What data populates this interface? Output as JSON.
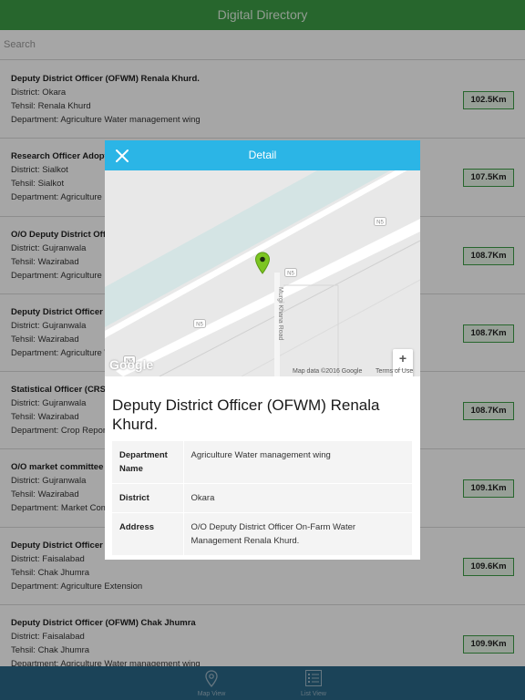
{
  "app": {
    "title": "Digital Directory"
  },
  "search": {
    "placeholder": "Search"
  },
  "list": [
    {
      "title": "Deputy District Officer (OFWM) Renala Khurd.",
      "district": "District: Okara",
      "tehsil": "Tehsil: Renala Khurd",
      "department": "Department: Agriculture Water management wing",
      "distance": "102.5Km"
    },
    {
      "title": "Research Officer Adopti",
      "district": "District: Sialkot",
      "tehsil": "Tehsil: Sialkot",
      "department": "Department: Agriculture F",
      "distance": "107.5Km"
    },
    {
      "title": "O/O Deputy District Offic",
      "district": "District: Gujranwala",
      "tehsil": "Tehsil: Wazirabad",
      "department": "Department: Agriculture E",
      "distance": "108.7Km"
    },
    {
      "title": "Deputy District Officer (C",
      "district": "District: Gujranwala",
      "tehsil": "Tehsil: Wazirabad",
      "department": "Department: Agriculture W",
      "distance": "108.7Km"
    },
    {
      "title": "Statistical Officer (CRS)",
      "district": "District: Gujranwala",
      "tehsil": "Tehsil: Wazirabad",
      "department": "Department: Crop Report",
      "distance": "108.7Km"
    },
    {
      "title": "O/O market committee W",
      "district": "District: Gujranwala",
      "tehsil": "Tehsil: Wazirabad",
      "department": "Department: Market Com",
      "distance": "109.1Km"
    },
    {
      "title": "Deputy District Officer A",
      "district": "District: Faisalabad",
      "tehsil": "Tehsil: Chak Jhumra",
      "department": "Department: Agriculture Extension",
      "distance": "109.6Km"
    },
    {
      "title": "Deputy District Officer (OFWM) Chak Jhumra",
      "district": "District: Faisalabad",
      "tehsil": "Tehsil: Chak Jhumra",
      "department": "Department: Agriculture Water management wing",
      "distance": "109.9Km"
    }
  ],
  "tabs": {
    "map": "Map View",
    "list": "List View"
  },
  "detail": {
    "header": "Detail",
    "map": {
      "road_name": "Murgi Khana Road",
      "road_marker": "N5",
      "attribution": "Map data ©2016 Google",
      "terms": "Terms of Use",
      "logo": "Google",
      "zoom_in": "+",
      "zoom_out": "−"
    },
    "title": "Deputy District Officer (OFWM) Renala Khurd.",
    "fields": {
      "department_label": "Department Name",
      "department_value": "Agriculture Water management wing",
      "district_label": "District",
      "district_value": "Okara",
      "address_label": "Address",
      "address_value": "O/O Deputy District Officer On-Farm Water Management Renala Khurd."
    }
  },
  "colors": {
    "header_green": "#3c9d45",
    "modal_blue": "#2bb5e6",
    "tabbar": "#2a6787",
    "pin": "#7cc521"
  }
}
